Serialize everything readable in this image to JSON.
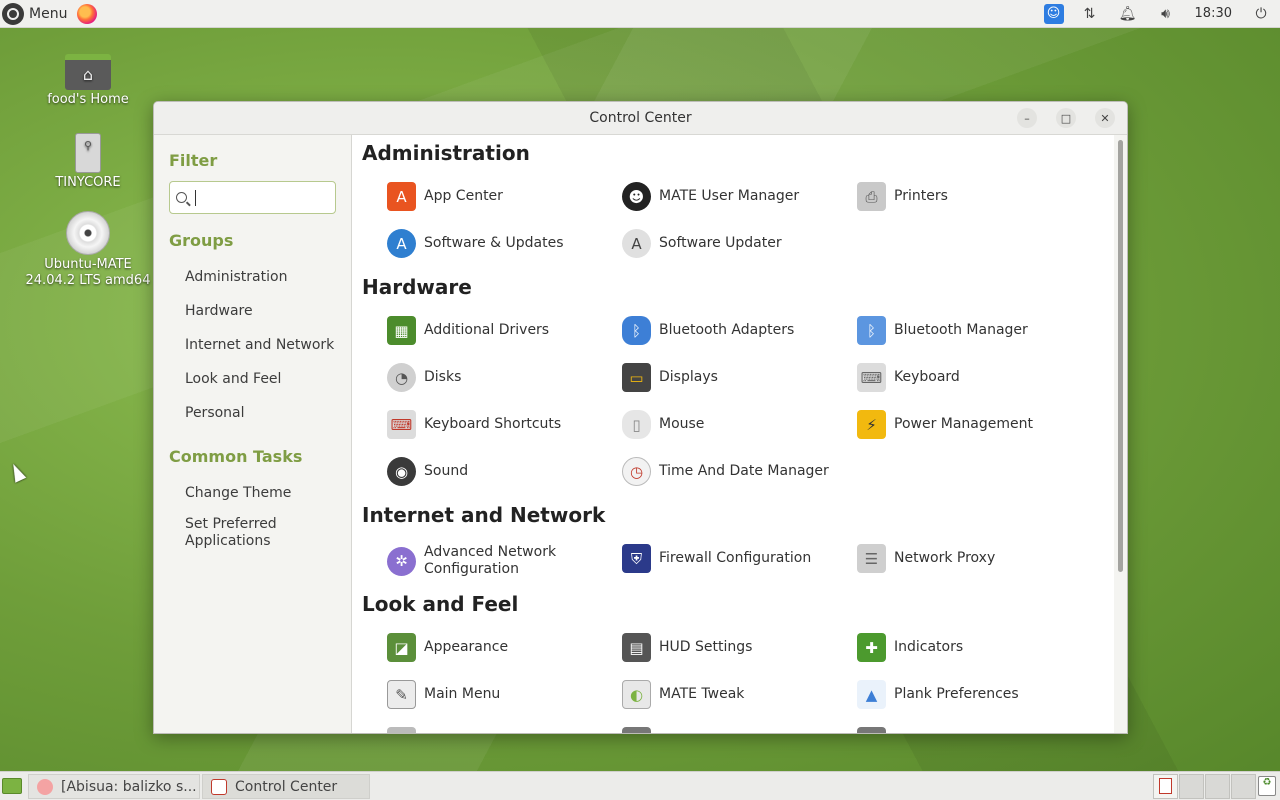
{
  "top_panel": {
    "menu_label": "Menu",
    "clock": "18:30"
  },
  "desktop": {
    "icons": [
      {
        "label": "food's Home"
      },
      {
        "label": "TINYCORE"
      },
      {
        "label": "Ubuntu-MATE 24.04.2 LTS amd64"
      }
    ]
  },
  "window": {
    "title": "Control Center",
    "sidebar": {
      "filter_heading": "Filter",
      "search_value": "",
      "groups_heading": "Groups",
      "groups": [
        "Administration",
        "Hardware",
        "Internet and Network",
        "Look and Feel",
        "Personal"
      ],
      "tasks_heading": "Common Tasks",
      "tasks": [
        "Change Theme",
        "Set Preferred Applications"
      ]
    },
    "sections": [
      {
        "title": "Administration",
        "items": [
          {
            "label": "App Center",
            "icon": "app-center-icon",
            "color": "#e95420"
          },
          {
            "label": "MATE User Manager",
            "icon": "users-icon",
            "color": "#222222"
          },
          {
            "label": "Printers",
            "icon": "printer-icon",
            "color": "#bdbdbd"
          },
          {
            "label": "Software & Updates",
            "icon": "software-updates-icon",
            "color": "#2f7fd0"
          },
          {
            "label": "Software Updater",
            "icon": "software-updater-icon",
            "color": "#555555"
          }
        ]
      },
      {
        "title": "Hardware",
        "items": [
          {
            "label": "Additional Drivers",
            "icon": "chip-icon",
            "color": "#4c8c2c"
          },
          {
            "label": "Bluetooth Adapters",
            "icon": "bluetooth-icon",
            "color": "#3d7fd6"
          },
          {
            "label": "Bluetooth Manager",
            "icon": "bluetooth-manager-icon",
            "color": "#3d7fd6"
          },
          {
            "label": "Disks",
            "icon": "disks-icon",
            "color": "#888888"
          },
          {
            "label": "Displays",
            "icon": "display-icon",
            "color": "#555555"
          },
          {
            "label": "Keyboard",
            "icon": "keyboard-icon",
            "color": "#bdbdbd"
          },
          {
            "label": "Keyboard Shortcuts",
            "icon": "keyboard-shortcuts-icon",
            "color": "#bdbdbd"
          },
          {
            "label": "Mouse",
            "icon": "mouse-icon",
            "color": "#d6d6d6"
          },
          {
            "label": "Power Management",
            "icon": "power-icon",
            "color": "#f2b90f"
          },
          {
            "label": "Sound",
            "icon": "speaker-icon",
            "color": "#3a3a3a"
          },
          {
            "label": "Time And Date Manager",
            "icon": "clock-icon",
            "color": "#e8e8e8"
          }
        ]
      },
      {
        "title": "Internet and Network",
        "items": [
          {
            "label": "Advanced Network Configuration",
            "icon": "network-icon",
            "color": "#8a6fd0"
          },
          {
            "label": "Firewall Configuration",
            "icon": "firewall-icon",
            "color": "#2b3a8a"
          },
          {
            "label": "Network Proxy",
            "icon": "proxy-icon",
            "color": "#a0a0a0"
          }
        ]
      },
      {
        "title": "Look and Feel",
        "items": [
          {
            "label": "Appearance",
            "icon": "appearance-icon",
            "color": "#5b8f3a"
          },
          {
            "label": "HUD Settings",
            "icon": "hud-icon",
            "color": "#555555"
          },
          {
            "label": "Indicators",
            "icon": "indicators-icon",
            "color": "#4c9a2e"
          },
          {
            "label": "Main Menu",
            "icon": "main-menu-icon",
            "color": "#777777"
          },
          {
            "label": "MATE Tweak",
            "icon": "tweak-icon",
            "color": "#7cb342"
          },
          {
            "label": "Plank Preferences",
            "icon": "plank-icon",
            "color": "#3d7fd6"
          }
        ]
      }
    ]
  },
  "taskbar": {
    "tasks": [
      "[Abisua: balizko s...",
      "Control Center"
    ]
  }
}
